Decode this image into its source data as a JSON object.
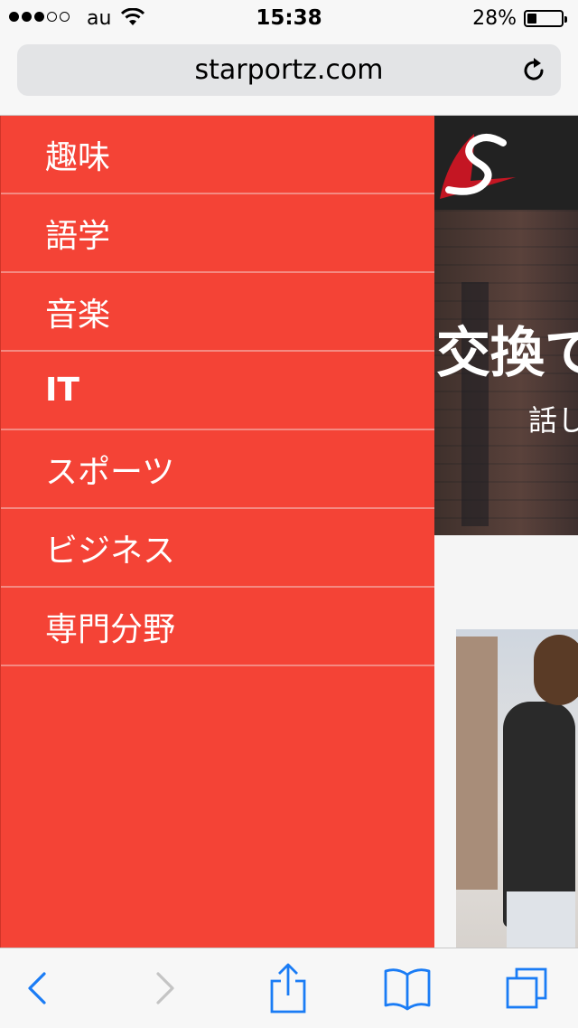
{
  "status_bar": {
    "carrier": "au",
    "time": "15:38",
    "battery_percent": "28%",
    "signal_dots_filled": 3,
    "signal_dots_total": 5,
    "battery_level": 0.28
  },
  "browser": {
    "url": "starportz.com",
    "reload_icon": "reload-icon"
  },
  "side_menu": {
    "items": [
      {
        "label": "趣味",
        "bold": false
      },
      {
        "label": "語学",
        "bold": false
      },
      {
        "label": "音楽",
        "bold": false
      },
      {
        "label": "IT",
        "bold": true
      },
      {
        "label": "スポーツ",
        "bold": false
      },
      {
        "label": "ビジネス",
        "bold": false
      },
      {
        "label": "専門分野",
        "bold": false
      }
    ]
  },
  "page": {
    "logo_letter": "S",
    "hero_title": "交換で",
    "hero_subtitle": "話し"
  },
  "toolbar": {
    "icons": [
      "back-icon",
      "forward-icon",
      "share-icon",
      "bookmarks-icon",
      "tabs-icon"
    ]
  },
  "colors": {
    "menu_bg": "#f44336",
    "menu_divider": "#f48a82",
    "ios_blue": "#1a7cf5",
    "disabled_gray": "#c4c4c4"
  }
}
